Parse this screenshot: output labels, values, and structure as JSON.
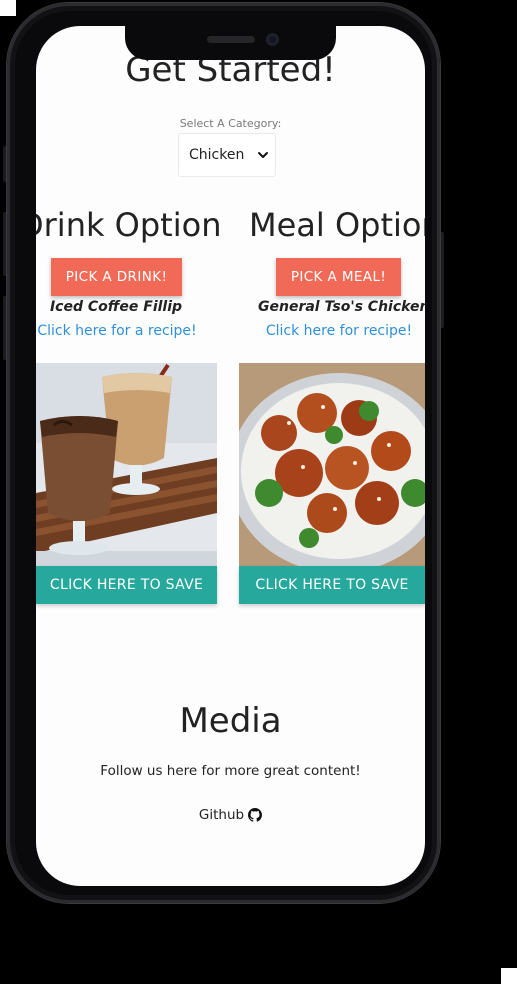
{
  "header": {
    "title": "Get Started!"
  },
  "category": {
    "label": "Select A Category:",
    "selected": "Chicken"
  },
  "drink": {
    "heading": "Drink Option",
    "button_label": "PICK A DRINK!",
    "item_name": "Iced Coffee Fillip",
    "recipe_link": "Click here for a recipe!",
    "save_label": "CLICK HERE TO SAVE"
  },
  "meal": {
    "heading": "Meal Option",
    "button_label": "PICK A MEAL!",
    "item_name": "General Tso's Chicken",
    "recipe_link": "Click here for recipe!",
    "save_label": "CLICK HERE TO SAVE"
  },
  "media": {
    "heading": "Media",
    "text": "Follow us here for more great content!",
    "github_label": "Github"
  },
  "colors": {
    "pick_button": "#f16a57",
    "save_button": "#27a89c",
    "link": "#2f8fd8"
  },
  "icons": {
    "select_arrow": "chevron-down-icon",
    "github": "github-icon"
  }
}
